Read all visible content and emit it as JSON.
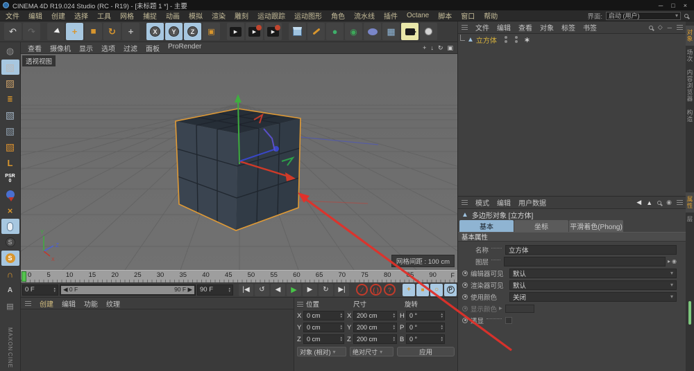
{
  "window": {
    "title": "CINEMA 4D R19.024 Studio (RC - R19) - [未标题 1 *] - 主要",
    "minimize": "─",
    "maximize": "□",
    "close": "×"
  },
  "menubar": {
    "items": [
      "文件",
      "编辑",
      "创建",
      "选择",
      "工具",
      "网格",
      "捕捉",
      "动画",
      "模拟",
      "渲染",
      "雕刻",
      "运动跟踪",
      "运动图形",
      "角色",
      "流水线",
      "插件",
      "Octane",
      "脚本",
      "窗口",
      "帮助"
    ],
    "interface_label": "界面:",
    "interface_value": "启动 (用户)"
  },
  "toolbar": {
    "axis_x": "X",
    "axis_y": "Y",
    "axis_z": "Z"
  },
  "sidebar": {
    "psr": "PSR",
    "psr_zero": "0",
    "snap_s": "S",
    "layer_a": "A",
    "brand_top": "MAXON",
    "brand_bottom": "CINE"
  },
  "viewport": {
    "menu": [
      "查看",
      "摄像机",
      "显示",
      "选项",
      "过滤",
      "面板",
      "ProRender"
    ],
    "view_label": "透视视图",
    "grid_spacing_label": "网格间距 : 100 cm"
  },
  "timeline": {
    "ticks": [
      "0",
      "5",
      "10",
      "15",
      "20",
      "25",
      "30",
      "35",
      "40",
      "45",
      "50",
      "55",
      "60",
      "65",
      "70",
      "75",
      "80",
      "85",
      "90"
    ],
    "unit": "F",
    "current_frame": "0 F",
    "range_start": "0 F",
    "range_end": "90 F",
    "end_frame": "90 F",
    "arrow_left": "◀",
    "arrow_right": "▶"
  },
  "material_manager": {
    "menu": [
      "创建",
      "编辑",
      "功能",
      "纹理"
    ]
  },
  "coordinates": {
    "columns": [
      "位置",
      "尺寸",
      "旋转"
    ],
    "rows": [
      {
        "pos_label": "X",
        "pos": "0 cm",
        "size_label": "X",
        "size": "200 cm",
        "rot_label": "H",
        "rot": "0 °"
      },
      {
        "pos_label": "Y",
        "pos": "0 cm",
        "size_label": "Y",
        "size": "200 cm",
        "rot_label": "P",
        "rot": "0 °"
      },
      {
        "pos_label": "Z",
        "pos": "0 cm",
        "size_label": "Z",
        "size": "200 cm",
        "rot_label": "B",
        "rot": "0 °"
      }
    ],
    "mode_position": "对象 (相对)",
    "mode_size": "绝对尺寸",
    "apply_label": "应用"
  },
  "object_manager": {
    "menu": [
      "文件",
      "编辑",
      "查看",
      "对象",
      "标签",
      "书签"
    ],
    "object_name": "立方体"
  },
  "attribute_manager": {
    "menu": [
      "模式",
      "编辑",
      "用户数据"
    ],
    "object_title": "多边形对象 [立方体]",
    "tabs": [
      "基本",
      "坐标",
      "平滑着色(Phong)"
    ],
    "section_title": "基本属性",
    "name_label": "名称",
    "name_value": "立方体",
    "layer_label": "图层",
    "editor_visible_label": "编辑器可见",
    "editor_visible_value": "默认",
    "render_visible_label": "渲染器可见",
    "render_visible_value": "默认",
    "use_color_label": "使用颜色",
    "use_color_value": "关闭",
    "display_color_label": "显示颜色",
    "xray_label": "透显"
  },
  "right_tabs": {
    "top": [
      "对象",
      "场次",
      "内容浏览器",
      "构造"
    ],
    "bottom": [
      "属性",
      "层"
    ]
  },
  "colors": {
    "accent_blue": "#8fb4d2",
    "selected_gold": "#d8b33c",
    "annotation_red": "#e0312a",
    "cube_outline": "#e09a35",
    "axis_green": "#3fae3f",
    "axis_red": "#d03a28",
    "axis_blue": "#3947c8"
  }
}
